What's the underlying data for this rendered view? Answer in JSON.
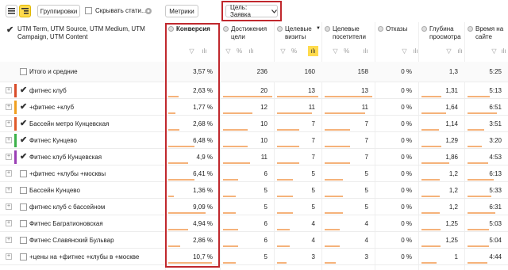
{
  "toolbar": {
    "groupings_label": "Группировки",
    "hide_stats_label": "Скрывать стати...",
    "metrics_label": "Метрики",
    "goal_label": "Цель: Заявка"
  },
  "header": {
    "dimension_title": "UTM Term, UTM Source, UTM Medium, UTM Campaign, UTM Content",
    "columns": [
      {
        "title": "Конверсия"
      },
      {
        "title": "Достижения цели"
      },
      {
        "title": "Целевые визиты"
      },
      {
        "title": "Целевые посетители"
      },
      {
        "title": "Отказы"
      },
      {
        "title": "Глубина просмотра"
      },
      {
        "title": "Время на сайте"
      }
    ],
    "sort_arrow": "▼"
  },
  "totals": {
    "label": "Итого и средние",
    "values": [
      "3,57 %",
      "236",
      "160",
      "158",
      "0 %",
      "1,3",
      "5:25"
    ]
  },
  "rows": [
    {
      "label": "фитнес клуб",
      "checked": true,
      "color": "#d94c2a",
      "values": [
        "2,63 %",
        "20",
        "13",
        "13",
        "0 %",
        "1,31",
        "5:13"
      ],
      "bars": [
        0.22,
        1.0,
        1.0,
        1.0,
        0,
        0.5,
        0.6
      ]
    },
    {
      "label": "+фитнес +клуб",
      "checked": true,
      "color": "#f0a020",
      "values": [
        "1,77 %",
        "12",
        "11",
        "11",
        "0 %",
        "1,64",
        "6:51"
      ],
      "bars": [
        0.15,
        0.6,
        0.85,
        0.85,
        0,
        0.62,
        0.8
      ]
    },
    {
      "label": "Бассейн метро Кунцевская",
      "checked": true,
      "color": "#e05a2a",
      "values": [
        "2,68 %",
        "10",
        "7",
        "7",
        "0 %",
        "1,14",
        "3:51"
      ],
      "bars": [
        0.23,
        0.5,
        0.54,
        0.54,
        0,
        0.43,
        0.45
      ]
    },
    {
      "label": "Фитнес Кунцево",
      "checked": true,
      "color": "#3db24a",
      "values": [
        "6,48 %",
        "10",
        "7",
        "7",
        "0 %",
        "1,29",
        "3:20"
      ],
      "bars": [
        0.55,
        0.5,
        0.54,
        0.54,
        0,
        0.49,
        0.39
      ]
    },
    {
      "label": "Фитнес клуб Кунцевская",
      "checked": true,
      "color": "#9a3fb5",
      "values": [
        "4,9 %",
        "11",
        "7",
        "7",
        "0 %",
        "1,86",
        "4:53"
      ],
      "bars": [
        0.42,
        0.55,
        0.54,
        0.54,
        0,
        0.7,
        0.57
      ]
    },
    {
      "label": "+фитнес +клубы +москвы",
      "checked": false,
      "color": "",
      "values": [
        "6,41 %",
        "6",
        "5",
        "5",
        "0 %",
        "1,2",
        "6:13"
      ],
      "bars": [
        0.55,
        0.3,
        0.38,
        0.38,
        0,
        0.45,
        0.72
      ]
    },
    {
      "label": "Бассейн Кунцево",
      "checked": false,
      "color": "",
      "values": [
        "1,36 %",
        "5",
        "5",
        "5",
        "0 %",
        "1,2",
        "5:33"
      ],
      "bars": [
        0.12,
        0.25,
        0.38,
        0.38,
        0,
        0.45,
        0.65
      ]
    },
    {
      "label": "фитнес клуб с бассейном",
      "checked": false,
      "color": "",
      "values": [
        "9,09 %",
        "5",
        "5",
        "5",
        "0 %",
        "1,2",
        "6:31"
      ],
      "bars": [
        0.78,
        0.25,
        0.38,
        0.38,
        0,
        0.45,
        0.76
      ]
    },
    {
      "label": "Фитнес Багратионовская",
      "checked": false,
      "color": "",
      "values": [
        "4,94 %",
        "6",
        "4",
        "4",
        "0 %",
        "1,25",
        "5:03"
      ],
      "bars": [
        0.42,
        0.3,
        0.31,
        0.31,
        0,
        0.47,
        0.59
      ]
    },
    {
      "label": "Фитнес Славянский Бульвар",
      "checked": false,
      "color": "",
      "values": [
        "2,86 %",
        "6",
        "4",
        "4",
        "0 %",
        "1,25",
        "5:04"
      ],
      "bars": [
        0.25,
        0.3,
        0.31,
        0.31,
        0,
        0.47,
        0.59
      ]
    },
    {
      "label": "+цены на +фитнес +клубы в +москве",
      "checked": false,
      "color": "",
      "values": [
        "10,7 %",
        "5",
        "3",
        "3",
        "0 %",
        "1",
        "4:44"
      ],
      "bars": [
        0.92,
        0.25,
        0.23,
        0.23,
        0,
        0.38,
        0.55
      ]
    }
  ],
  "icons": {
    "list_view": "list-icon",
    "tree_view": "tree-icon",
    "settings": "gear-icon",
    "filter": "filter-icon",
    "chart": "bar-chart-icon",
    "percent": "percent-icon"
  }
}
